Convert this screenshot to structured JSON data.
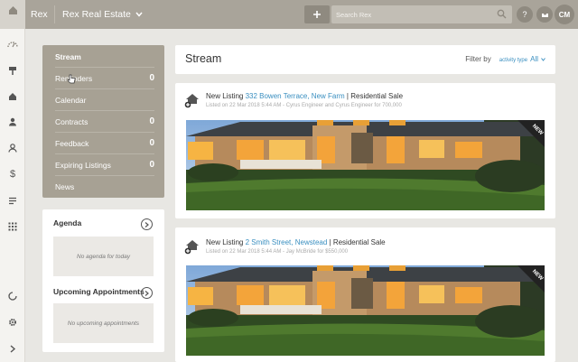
{
  "topbar": {
    "brand": "Rex",
    "account": "Rex Real Estate",
    "search_placeholder": "Search Rex",
    "help_label": "?",
    "avatar_initials": "CM"
  },
  "nav": {
    "items": [
      {
        "label": "Stream",
        "count": ""
      },
      {
        "label": "Reminders",
        "count": "0"
      },
      {
        "label": "Calendar",
        "count": ""
      },
      {
        "label": "Contracts",
        "count": "0"
      },
      {
        "label": "Feedback",
        "count": "0"
      },
      {
        "label": "Expiring Listings",
        "count": "0"
      },
      {
        "label": "News",
        "count": ""
      }
    ]
  },
  "agenda": {
    "title": "Agenda",
    "empty": "No agenda for today"
  },
  "appointments": {
    "title": "Upcoming Appointments",
    "empty": "No upcoming appointments"
  },
  "stream": {
    "title": "Stream",
    "filter_label": "Filter by",
    "filter_type": "activity type",
    "filter_value": "All"
  },
  "cards": [
    {
      "prefix": "New Listing ",
      "address": "332 Bowen Terrace, New Farm",
      "suffix": " | Residential Sale",
      "meta": "Listed on 22 Mar 2018 5:44 AM - Cyrus Engineer and Cyrus Engineer for 700,000",
      "badge": "NEW"
    },
    {
      "prefix": "New Listing ",
      "address": "2 Smith Street, Newstead",
      "suffix": " | Residential Sale",
      "meta": "Listed on 22 Mar 2018 5:44 AM - Jay McBride for $550,000",
      "badge": "NEW"
    }
  ],
  "colors": {
    "topbar": "#a9a49a",
    "nav_panel": "#a7a194",
    "link": "#3a8fc0"
  }
}
